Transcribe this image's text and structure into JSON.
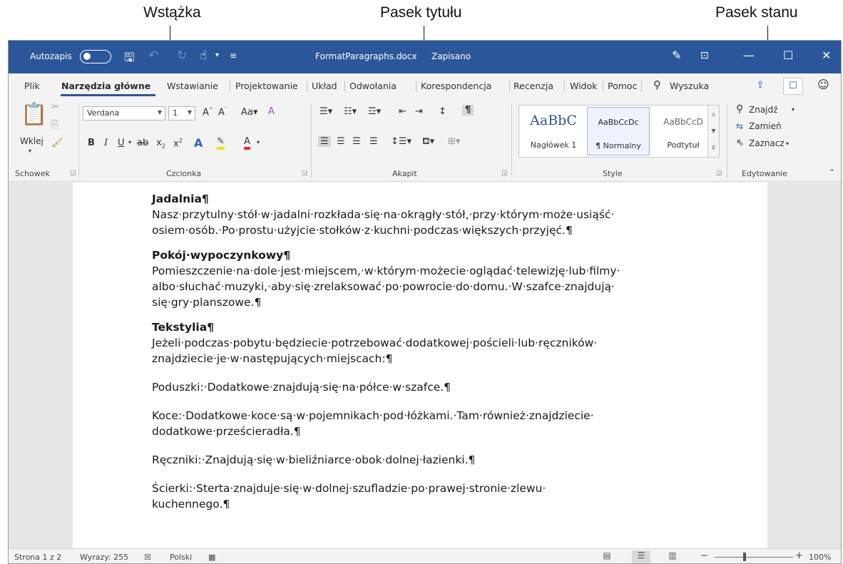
{
  "callouts": {
    "ribbon": "Wstążka",
    "title_bar": "Pasek tytułu",
    "status_bar": "Pasek stanu"
  },
  "titlebar": {
    "autosave_label": "Autozapis",
    "document_name": "FormatParagraphs.docx",
    "save_state": "Zapisano",
    "bg_color": "#2b579a"
  },
  "tabs": {
    "items": [
      "Plik",
      "Narzędzia główne",
      "Wstawianie",
      "Projektowanie",
      "Układ",
      "Odwołania",
      "Korespondencja",
      "Recenzja",
      "Widok",
      "Pomoc"
    ],
    "search_label": "Wyszuka",
    "active": "Narzędzia główne"
  },
  "ribbon": {
    "clipboard": {
      "paste_label": "Wklej",
      "group_label": "Schowek"
    },
    "font": {
      "font_name": "Verdana",
      "font_size": "1",
      "group_label": "Czcionka"
    },
    "paragraph": {
      "group_label": "Akapit"
    },
    "styles": {
      "group_label": "Style",
      "tiles": [
        {
          "sample": "AaBbC",
          "name": "Nagłówek 1"
        },
        {
          "sample": "AaBbCcDc",
          "name": "¶ Normalny"
        },
        {
          "sample": "AaBbCcD",
          "name": "Podtytuł"
        }
      ]
    },
    "editing": {
      "group_label": "Edytowanie",
      "find": "Znajdź",
      "replace": "Zamień",
      "select": "Zaznacz"
    }
  },
  "document": {
    "blocks": [
      {
        "heading": "Jadalnia¶",
        "lines": [
          "Nasz·przytulny·stół·w·jadalni·rozkłada·się·na·okrągły·stół,·przy·którym·może·usiąść·",
          "osiem·osób.·Po·prostu·użyjcie·stołków·z·kuchni·podczas·większych·przyjęć.¶"
        ]
      },
      {
        "heading": "Pokój·wypoczynkowy¶",
        "lines": [
          "Pomieszczenie·na·dole·jest·miejscem,·w·którym·możecie·oglądać·telewizję·lub·filmy·",
          "albo·słuchać·muzyki,·aby·się·zrelaksować·po·powrocie·do·domu.·W·szafce·znajdują·",
          "się·gry·planszowe.¶"
        ]
      },
      {
        "heading": "Tekstylia¶",
        "lines": [
          "Jeżeli·podczas·pobytu·będziecie·potrzebować·dodatkowej·pościeli·lub·ręczników·",
          "znajdziecie·je·w·następujących·miejscach:¶"
        ]
      },
      {
        "heading": "",
        "lines": [
          "Poduszki:·Dodatkowe·znajdują·się·na·półce·w·szafce.¶"
        ]
      },
      {
        "heading": "",
        "lines": [
          "Koce:·Dodatkowe·koce·są·w·pojemnikach·pod·łóżkami.·Tam·również·znajdziecie·",
          "dodatkowe·prześcieradła.¶"
        ]
      },
      {
        "heading": "",
        "lines": [
          "Ręczniki:·Znajdują·się·w·bieliźniarce·obok·dolnej·łazienki.¶"
        ]
      },
      {
        "heading": "",
        "lines": [
          "Ścierki:·Sterta·znajduje·się·w·dolnej·szufladzie·po·prawej·stronie·zlewu·",
          "kuchennego.¶"
        ]
      }
    ]
  },
  "statusbar": {
    "page": "Strona 1 z 2",
    "words": "Wyrazy: 255",
    "language": "Polski",
    "zoom": "100%"
  }
}
